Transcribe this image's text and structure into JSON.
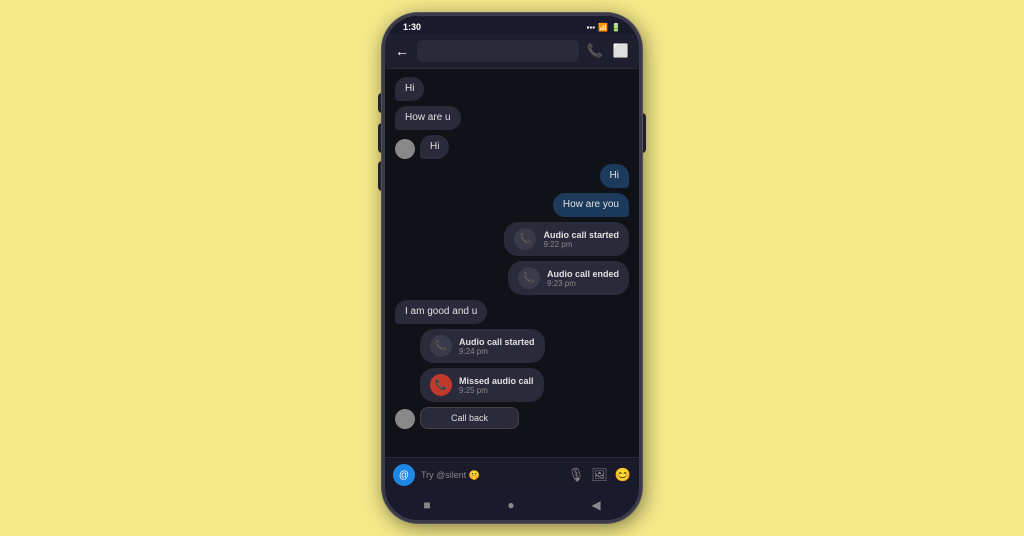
{
  "status_bar": {
    "time": "1:30",
    "signal_icon": "signal-icon",
    "wifi_icon": "wifi-icon",
    "battery_icon": "battery-icon"
  },
  "header": {
    "back_label": "←",
    "phone_icon": "phone-icon",
    "video_icon": "video-icon"
  },
  "messages": [
    {
      "id": 1,
      "type": "received_no_avatar",
      "text": "Hi"
    },
    {
      "id": 2,
      "type": "received_no_avatar",
      "text": "How are u"
    },
    {
      "id": 3,
      "type": "received_avatar",
      "text": "Hi"
    },
    {
      "id": 4,
      "type": "sent",
      "text": "Hi"
    },
    {
      "id": 5,
      "type": "sent",
      "text": "How are you"
    },
    {
      "id": 6,
      "type": "call_sent",
      "title": "Audio call started",
      "time": "9:22 pm"
    },
    {
      "id": 7,
      "type": "call_sent",
      "title": "Audio call ended",
      "time": "9:23 pm"
    },
    {
      "id": 8,
      "type": "text_received",
      "text": "I am good and u"
    },
    {
      "id": 9,
      "type": "call_received",
      "title": "Audio call started",
      "time": "9:24 pm",
      "icon_type": "normal"
    },
    {
      "id": 10,
      "type": "missed_call",
      "title": "Missed audio call",
      "time": "9:25 pm"
    },
    {
      "id": 11,
      "type": "call_back",
      "label": "Call back"
    }
  ],
  "input_bar": {
    "placeholder": "Try @silent 🤫",
    "mic_icon": "mic-icon",
    "image_icon": "image-icon",
    "emoji_icon": "emoji-icon"
  },
  "bottom_nav": {
    "square_icon": "square-icon",
    "circle_icon": "circle-icon",
    "triangle_icon": "triangle-icon"
  }
}
